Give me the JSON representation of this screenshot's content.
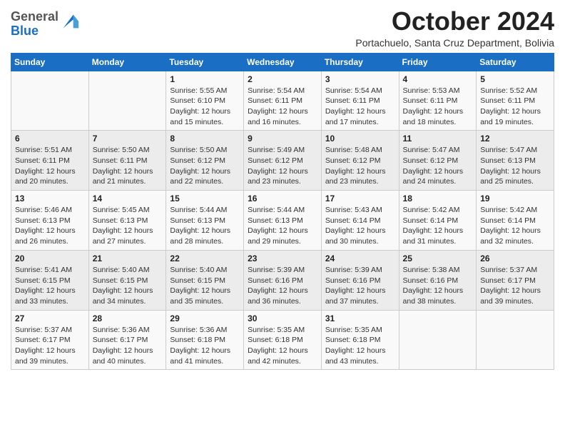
{
  "logo": {
    "general": "General",
    "blue": "Blue"
  },
  "header": {
    "month": "October 2024",
    "location": "Portachuelo, Santa Cruz Department, Bolivia"
  },
  "weekdays": [
    "Sunday",
    "Monday",
    "Tuesday",
    "Wednesday",
    "Thursday",
    "Friday",
    "Saturday"
  ],
  "weeks": [
    [
      {
        "day": "",
        "info": ""
      },
      {
        "day": "",
        "info": ""
      },
      {
        "day": "1",
        "info": "Sunrise: 5:55 AM\nSunset: 6:10 PM\nDaylight: 12 hours and 15 minutes."
      },
      {
        "day": "2",
        "info": "Sunrise: 5:54 AM\nSunset: 6:11 PM\nDaylight: 12 hours and 16 minutes."
      },
      {
        "day": "3",
        "info": "Sunrise: 5:54 AM\nSunset: 6:11 PM\nDaylight: 12 hours and 17 minutes."
      },
      {
        "day": "4",
        "info": "Sunrise: 5:53 AM\nSunset: 6:11 PM\nDaylight: 12 hours and 18 minutes."
      },
      {
        "day": "5",
        "info": "Sunrise: 5:52 AM\nSunset: 6:11 PM\nDaylight: 12 hours and 19 minutes."
      }
    ],
    [
      {
        "day": "6",
        "info": "Sunrise: 5:51 AM\nSunset: 6:11 PM\nDaylight: 12 hours and 20 minutes."
      },
      {
        "day": "7",
        "info": "Sunrise: 5:50 AM\nSunset: 6:11 PM\nDaylight: 12 hours and 21 minutes."
      },
      {
        "day": "8",
        "info": "Sunrise: 5:50 AM\nSunset: 6:12 PM\nDaylight: 12 hours and 22 minutes."
      },
      {
        "day": "9",
        "info": "Sunrise: 5:49 AM\nSunset: 6:12 PM\nDaylight: 12 hours and 23 minutes."
      },
      {
        "day": "10",
        "info": "Sunrise: 5:48 AM\nSunset: 6:12 PM\nDaylight: 12 hours and 23 minutes."
      },
      {
        "day": "11",
        "info": "Sunrise: 5:47 AM\nSunset: 6:12 PM\nDaylight: 12 hours and 24 minutes."
      },
      {
        "day": "12",
        "info": "Sunrise: 5:47 AM\nSunset: 6:13 PM\nDaylight: 12 hours and 25 minutes."
      }
    ],
    [
      {
        "day": "13",
        "info": "Sunrise: 5:46 AM\nSunset: 6:13 PM\nDaylight: 12 hours and 26 minutes."
      },
      {
        "day": "14",
        "info": "Sunrise: 5:45 AM\nSunset: 6:13 PM\nDaylight: 12 hours and 27 minutes."
      },
      {
        "day": "15",
        "info": "Sunrise: 5:44 AM\nSunset: 6:13 PM\nDaylight: 12 hours and 28 minutes."
      },
      {
        "day": "16",
        "info": "Sunrise: 5:44 AM\nSunset: 6:13 PM\nDaylight: 12 hours and 29 minutes."
      },
      {
        "day": "17",
        "info": "Sunrise: 5:43 AM\nSunset: 6:14 PM\nDaylight: 12 hours and 30 minutes."
      },
      {
        "day": "18",
        "info": "Sunrise: 5:42 AM\nSunset: 6:14 PM\nDaylight: 12 hours and 31 minutes."
      },
      {
        "day": "19",
        "info": "Sunrise: 5:42 AM\nSunset: 6:14 PM\nDaylight: 12 hours and 32 minutes."
      }
    ],
    [
      {
        "day": "20",
        "info": "Sunrise: 5:41 AM\nSunset: 6:15 PM\nDaylight: 12 hours and 33 minutes."
      },
      {
        "day": "21",
        "info": "Sunrise: 5:40 AM\nSunset: 6:15 PM\nDaylight: 12 hours and 34 minutes."
      },
      {
        "day": "22",
        "info": "Sunrise: 5:40 AM\nSunset: 6:15 PM\nDaylight: 12 hours and 35 minutes."
      },
      {
        "day": "23",
        "info": "Sunrise: 5:39 AM\nSunset: 6:16 PM\nDaylight: 12 hours and 36 minutes."
      },
      {
        "day": "24",
        "info": "Sunrise: 5:39 AM\nSunset: 6:16 PM\nDaylight: 12 hours and 37 minutes."
      },
      {
        "day": "25",
        "info": "Sunrise: 5:38 AM\nSunset: 6:16 PM\nDaylight: 12 hours and 38 minutes."
      },
      {
        "day": "26",
        "info": "Sunrise: 5:37 AM\nSunset: 6:17 PM\nDaylight: 12 hours and 39 minutes."
      }
    ],
    [
      {
        "day": "27",
        "info": "Sunrise: 5:37 AM\nSunset: 6:17 PM\nDaylight: 12 hours and 39 minutes."
      },
      {
        "day": "28",
        "info": "Sunrise: 5:36 AM\nSunset: 6:17 PM\nDaylight: 12 hours and 40 minutes."
      },
      {
        "day": "29",
        "info": "Sunrise: 5:36 AM\nSunset: 6:18 PM\nDaylight: 12 hours and 41 minutes."
      },
      {
        "day": "30",
        "info": "Sunrise: 5:35 AM\nSunset: 6:18 PM\nDaylight: 12 hours and 42 minutes."
      },
      {
        "day": "31",
        "info": "Sunrise: 5:35 AM\nSunset: 6:18 PM\nDaylight: 12 hours and 43 minutes."
      },
      {
        "day": "",
        "info": ""
      },
      {
        "day": "",
        "info": ""
      }
    ]
  ]
}
